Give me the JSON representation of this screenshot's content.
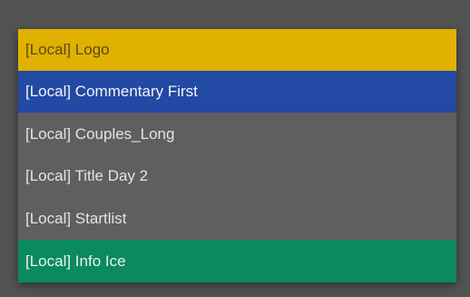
{
  "list": {
    "items": [
      {
        "label": "[Local] Logo",
        "color": "#e0b100"
      },
      {
        "label": "[Local] Commentary First",
        "color": "#2249a3"
      },
      {
        "label": "[Local] Couples_Long",
        "color": "#5f5f5f"
      },
      {
        "label": "[Local] Title Day 2",
        "color": "#5f5f5f"
      },
      {
        "label": "[Local] Startlist",
        "color": "#5f5f5f"
      },
      {
        "label": "[Local] Info Ice",
        "color": "#0b8a5f"
      }
    ]
  }
}
